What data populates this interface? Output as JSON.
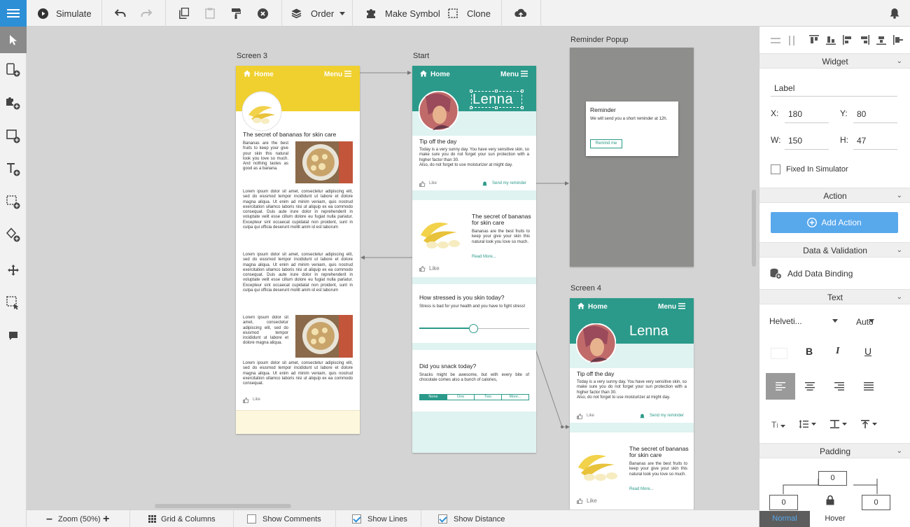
{
  "toolbar": {
    "simulate": "Simulate",
    "order": "Order",
    "make_symbol": "Make Symbol",
    "clone": "Clone"
  },
  "screens": {
    "screen3": {
      "label": "Screen 3",
      "home": "Home",
      "menu": "Menu",
      "title": "The secret of bananas for skin care",
      "intro": "Bananas are the best fruits to keep your give your skin this natural look you love so much. And nothing tastes as good as a banana.",
      "lorem1": "Lorem ipsum dolor sit amet, consectetur adipiscing elit, sed do eiusmod tempor incididunt ut labore et dolore magna aliqua. Ut enim ad minim veniam, quis nostrud exercitation ullamco laboris nisi ut aliquip ex ea commodo consequat. Duis aute irure dolor in reprehenderit in voluptate velit esse cillum dolore eu fugiat nulla pariatur. Excepteur sint occaecat cupidatat non proident, sunt in culpa qui officia deserunt mollit anim id est laborum",
      "lorem2": "Lorem ipsum dolor sit amet, consectetur adipiscing elit, sed do eiusmod tempor incididunt ut labore et dolore magna aliqua. Ut enim ad minim veniam, quis nostrud exercitation ullamco laboris nisi ut aliquip ex ea commodo consequat. Duis aute irure dolor in reprehenderit in voluptate velit esse cillum dolore eu fugiat nulla pariatur. Excepteur sint occaecat cupidatat non proident, sunt in culpa qui officia deserunt mollit anim id est laborum",
      "lorem3": "Lorem ipsum dolor sit amet, consectetur adipiscing elit, sed do eiusmod tempor incididunt ut labore et dolore magna aliqua.",
      "lorem4": "Lorem ipsum dolor sit amet, consectetur adipiscing elit, sed do eiusmod tempor incididunt ut labore et dolore magna aliqua. Ut enim ad minim veniam, quis nostrud exercitation ullamco laboris nisi ut aliquip ex ea commodo consequat.",
      "like": "Like"
    },
    "start": {
      "label": "Start",
      "home": "Home",
      "menu": "Menu",
      "name": "Lenna",
      "tip_title": "Tip off the day",
      "tip_text": "Today is a very sunny day. You have very sensitive skin, so make sure you do not forget your sun protection with a higher factor than 30.\nAlso, do not forget to use moisturizer at might day.",
      "like": "Like",
      "send_reminder": "Send my reminder",
      "banana_title": "The secret of bananas for skin care",
      "banana_text": "Bananas are the best fruits to keep your give your skin this natural look you love so much.",
      "read_more": "Read More...",
      "like2": "Like",
      "stress_title": "How stressed is you skin today?",
      "stress_text": "Stress is bad for your health and you have to fight stress!",
      "snack_title": "Did you snack today?",
      "snack_text": "Snacks might be awesome, but with every bite of chocolate comes also a bunch of calories,",
      "segments": [
        "None",
        "One",
        "Two",
        "More..."
      ]
    },
    "popup": {
      "label": "Reminder Popup",
      "title": "Reminder",
      "text": "We will send you a short reminder at 12h.",
      "button": "Remind me"
    },
    "screen4": {
      "label": "Screen 4",
      "home": "Home",
      "menu": "Menu",
      "name": "Lenna",
      "tip_title": "Tip off the day",
      "tip_text": "Today is a very sunny day. You have very sensitive skin, so make sure you do not forget your sun protection with a higher factor than 30.\nAlso, do not forget to use moisturizer at might day.",
      "like": "Like",
      "send_reminder": "Send my reminder",
      "banana_title": "The secret of bananas for skin care",
      "banana_text": "Bananas are the best fruits to keep your give your skin this natural look you love so much.",
      "read_more": "Read More...",
      "like2": "Like"
    }
  },
  "panel": {
    "widget_header": "Widget",
    "label_value": "Label",
    "x_label": "X:",
    "x_value": "180",
    "y_label": "Y:",
    "y_value": "80",
    "w_label": "W:",
    "w_value": "150",
    "h_label": "H:",
    "h_value": "47",
    "fixed_label": "Fixed In Simulator",
    "action_header": "Action",
    "add_action": "Add Action",
    "data_header": "Data & Validation",
    "add_binding": "Add Data Binding",
    "text_header": "Text",
    "font": "Helveti...",
    "size": "Auto",
    "padding_header": "Padding",
    "pad_top": "0",
    "pad_left": "0",
    "pad_right": "0",
    "tab_normal": "Normal",
    "tab_hover": "Hover"
  },
  "bottom": {
    "zoom": "Zoom (50%)",
    "grid": "Grid & Columns",
    "show_comments": "Show Comments",
    "show_lines": "Show Lines",
    "show_distance": "Show Distance"
  },
  "colors": {
    "accent": "#2d8fd6",
    "teal": "#2b9a8a",
    "yellow": "#f0d02e",
    "add_action": "#58a8ec"
  }
}
